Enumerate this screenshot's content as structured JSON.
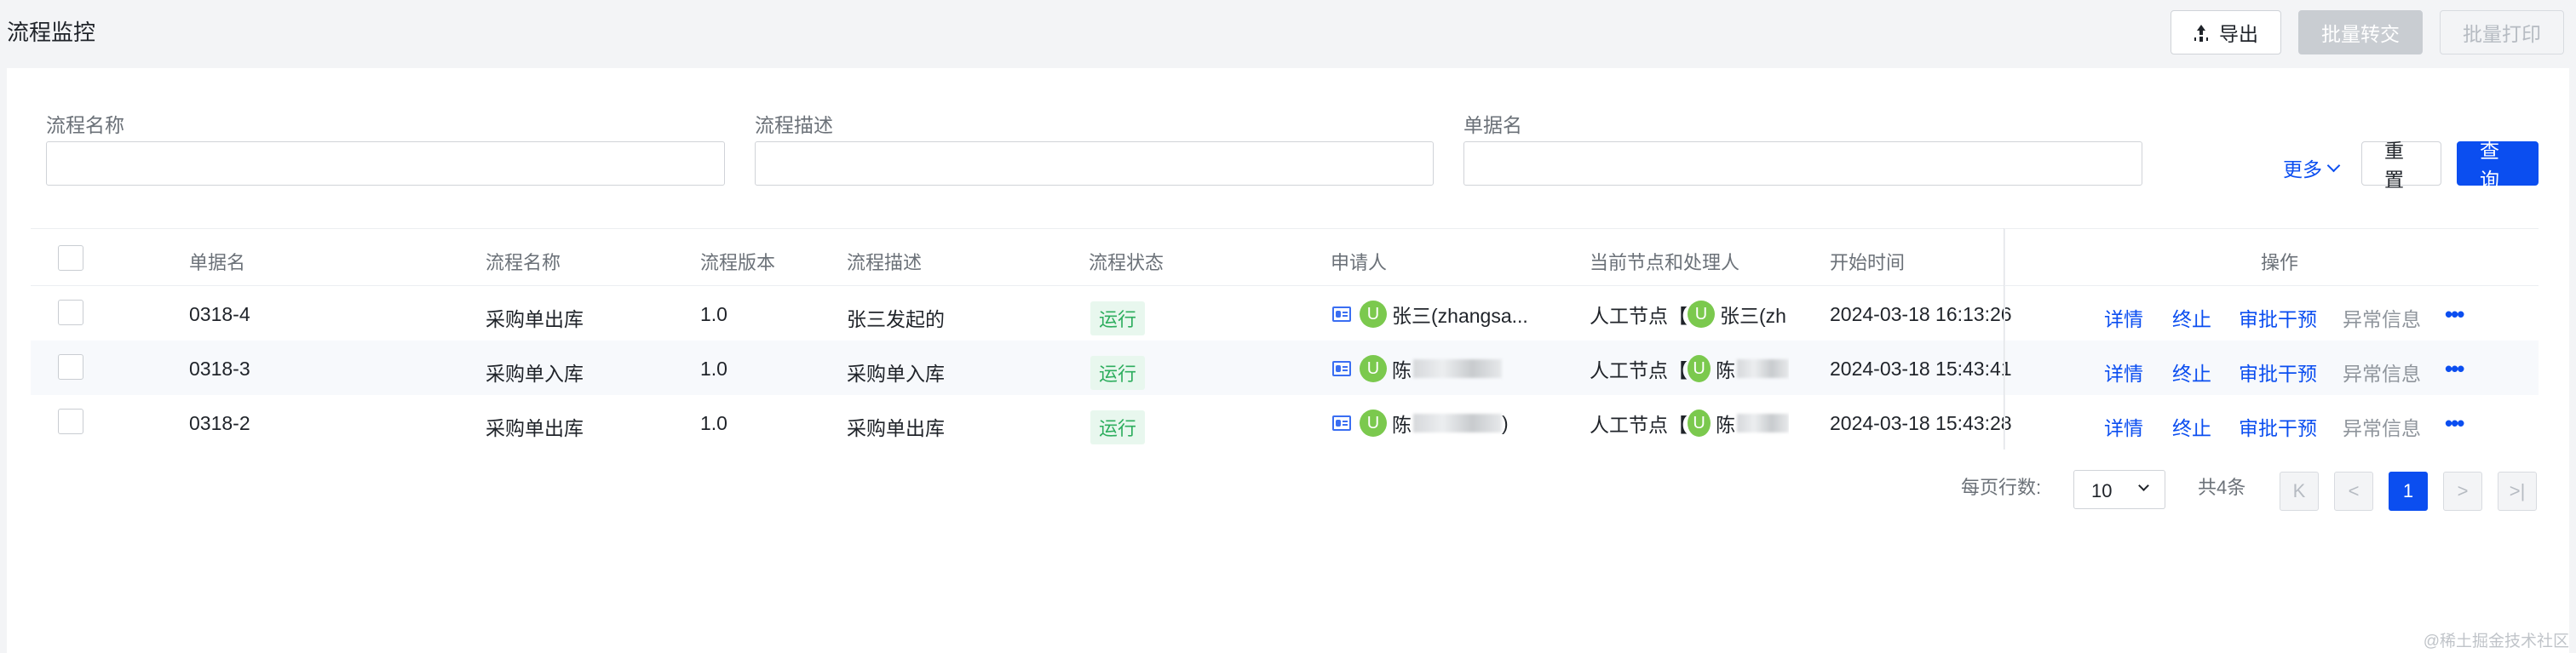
{
  "header": {
    "title": "流程监控",
    "export_label": "导出",
    "batch_transfer_label": "批量转交",
    "batch_print_label": "批量打印"
  },
  "filters": {
    "fields": [
      {
        "label": "流程名称",
        "value": ""
      },
      {
        "label": "流程描述",
        "value": ""
      },
      {
        "label": "单据名",
        "value": ""
      }
    ],
    "more_label": "更多",
    "reset_label": "重置",
    "query_label": "查询"
  },
  "table": {
    "columns": [
      "单据名",
      "流程名称",
      "流程版本",
      "流程描述",
      "流程状态",
      "申请人",
      "当前节点和处理人",
      "开始时间",
      "操作"
    ],
    "rows": [
      {
        "doc": "0318-4",
        "process": "采购单出库",
        "version": "1.0",
        "desc": "张三发起的",
        "status": "运行",
        "avatar": "U",
        "applicant": "张三(zhangsa...",
        "node": "人工节点【",
        "handler": "张三(zh",
        "start": "2024-03-18 16:13:26"
      },
      {
        "doc": "0318-3",
        "process": "采购单入库",
        "version": "1.0",
        "desc": "采购单入库",
        "status": "运行",
        "avatar": "U",
        "applicant": "陈",
        "node": "人工节点【",
        "handler": "陈",
        "start": "2024-03-18 15:43:41"
      },
      {
        "doc": "0318-2",
        "process": "采购单出库",
        "version": "1.0",
        "desc": "采购单出库",
        "status": "运行",
        "avatar": "U",
        "applicant": "陈",
        "applicant_tail": ")",
        "node": "人工节点【",
        "handler": "陈",
        "start": "2024-03-18 15:43:28"
      }
    ],
    "actions": {
      "detail": "详情",
      "terminate": "终止",
      "intervene": "审批干预",
      "exception": "异常信息",
      "more": "•••"
    }
  },
  "pagination": {
    "rows_per_page_label": "每页行数:",
    "rows_per_page": "10",
    "total": "共4条",
    "first": "K",
    "prev": "<",
    "current_page": "1",
    "next": ">",
    "last": ">|"
  },
  "watermark": "@稀土掘金技术社区",
  "colors": {
    "primary": "#0b4ef0",
    "status_green": "#2eae5e",
    "avatar_green": "#7bc94e"
  }
}
